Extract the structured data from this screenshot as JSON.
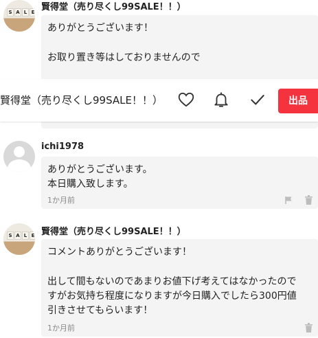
{
  "comments": [
    {
      "user": "賢得堂（売り尽くし99SALE！！）",
      "avatar_text": "SALE",
      "lines": [
        "ありがとうございます！",
        "",
        "お取り置き等はしておりませんので"
      ]
    },
    {
      "user": "ichi1978",
      "lines": [
        "ありがとうございます。",
        "本日購入致します。"
      ],
      "time": "1か月前"
    },
    {
      "user": "賢得堂（売り尽くし99SALE！！）",
      "avatar_text": "SALE",
      "lines": [
        "コメントありがとうございます！",
        "",
        "出して間もないのであまりお値下げ考えてはなかったので",
        "すがお気持ち程度になりますが今日購入でしたら300円値",
        "引きさせてもらいます！"
      ],
      "time": "1か月前"
    }
  ],
  "action_bar": {
    "seller_name": "賢得堂（売り尽くし99SALE！！）",
    "icons": [
      "heart-icon",
      "bell-icon",
      "check-icon"
    ],
    "sell_label": "出品"
  },
  "colors": {
    "accent": "#f5333f",
    "bubble": "#f4f4f4",
    "timestamp": "#888888"
  }
}
